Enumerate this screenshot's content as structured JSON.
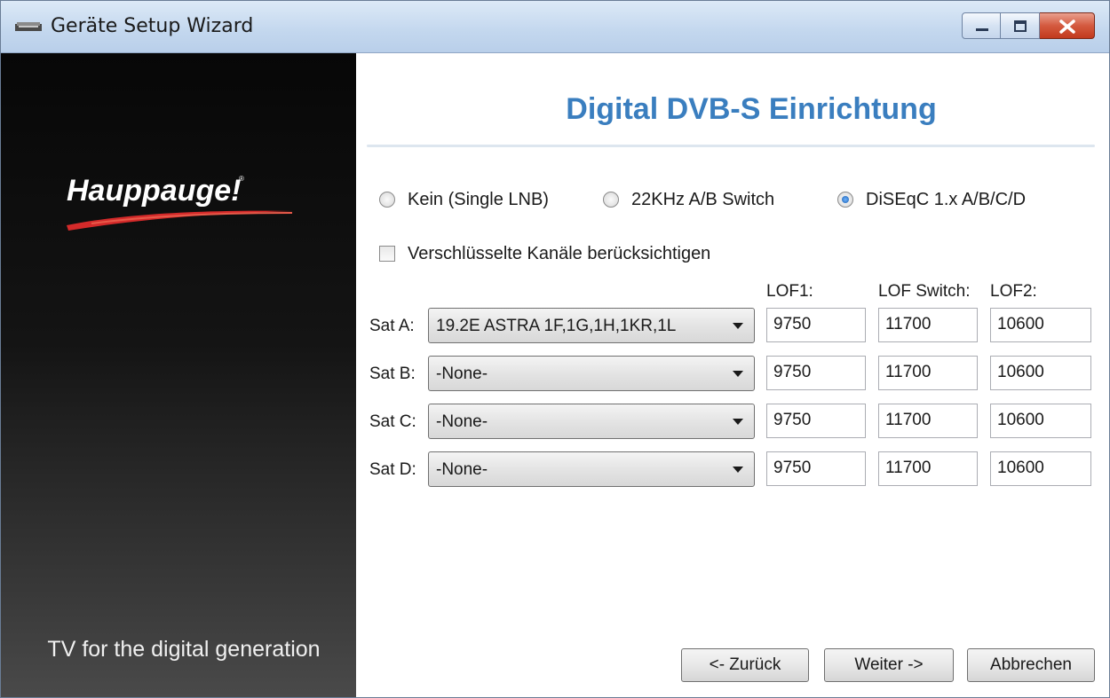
{
  "window": {
    "title": "Geräte Setup Wizard"
  },
  "sidebar": {
    "logo_text": "Hauppauge!",
    "tagline": "TV for the digital generation"
  },
  "main": {
    "heading": "Digital DVB-S Einrichtung",
    "radios": [
      {
        "label": "Kein (Single LNB)",
        "selected": false
      },
      {
        "label": "22KHz A/B Switch",
        "selected": false
      },
      {
        "label": "DiSEqC 1.x A/B/C/D",
        "selected": true
      }
    ],
    "checkbox": {
      "label": "Verschlüsselte Kanäle berücksichtigen",
      "checked": false
    },
    "columns": {
      "lof1": "LOF1:",
      "lof_switch": "LOF Switch:",
      "lof2": "LOF2:"
    },
    "rows": [
      {
        "label": "Sat A:",
        "satellite": "19.2E ASTRA 1F,1G,1H,1KR,1L",
        "lof1": "9750",
        "lof_switch": "11700",
        "lof2": "10600"
      },
      {
        "label": "Sat B:",
        "satellite": "-None-",
        "lof1": "9750",
        "lof_switch": "11700",
        "lof2": "10600"
      },
      {
        "label": "Sat C:",
        "satellite": "-None-",
        "lof1": "9750",
        "lof_switch": "11700",
        "lof2": "10600"
      },
      {
        "label": "Sat D:",
        "satellite": "-None-",
        "lof1": "9750",
        "lof_switch": "11700",
        "lof2": "10600"
      }
    ],
    "buttons": {
      "back": "<- Zurück",
      "next": "Weiter ->",
      "cancel": "Abbrechen"
    }
  },
  "colors": {
    "heading": "#3a7ebf",
    "logo_swoosh": "#d42a2a"
  }
}
